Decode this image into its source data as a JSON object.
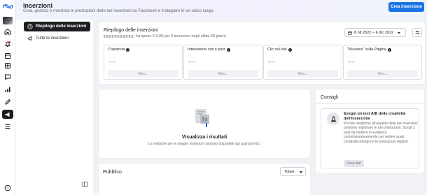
{
  "header": {
    "title": "Inserzioni",
    "subtitle": "Crea, gestisci e monitora le prestazioni delle tue inserzioni su Facebook e Instagram in un unico luogo.",
    "create_button": "Crea inserzione"
  },
  "rail": {
    "icons": [
      "meta-logo",
      "avatar",
      "home-icon",
      "bell-icon",
      "pages-icon",
      "inbox-icon",
      "messages-icon",
      "insights-icon",
      "edit-icon",
      "ads-icon",
      "menu-icon",
      "help-icon"
    ]
  },
  "nav": {
    "items": [
      {
        "label": "Riepilogo delle inserzioni",
        "icon": "overview-icon",
        "active": true
      },
      {
        "label": "Tutte le inserzioni",
        "icon": "megaphone-icon",
        "active": false
      }
    ]
  },
  "summary": {
    "title": "Riepilogo delle inserzioni",
    "description": "ha speso € 0,00 per 0 inserzioni negli ultimi 60 giorni.",
    "date_range": "8 ott 2022 – 6 dic 2022",
    "metrics": [
      {
        "label": "Copertura",
        "value": "––",
        "button": "Altro..."
      },
      {
        "label": "Interazione con il post",
        "value": "––",
        "button": "Altro..."
      },
      {
        "label": "Clic sul link",
        "value": "––",
        "button": "Altro..."
      },
      {
        "label": "\"Mi piace\" sulla Pagina",
        "value": "––",
        "button": "Altro..."
      }
    ]
  },
  "results": {
    "title": "Visualizza i risultati",
    "description": "Le metriche per le singole inserzioni saranno disponibili qui quando inizi."
  },
  "public": {
    "title": "Pubblico",
    "select_value": "Totale"
  },
  "tips": {
    "title": "Consigli",
    "card_title": "Esegui un test A/B delle creatività dell'inserzione",
    "card_body": "Piccole modifiche all'aspetto delle tue inserzioni possono migliorare le tue prestazioni. Scegli 2 post da mettere in evidenza contemporaneamente per vedere quali creatività ottengono le prestazioni migliori.",
    "card_button": "Crea test"
  },
  "colors": {
    "accent": "#1b74e4",
    "active_nav": "#1c1e21",
    "background": "#f0f2f5"
  }
}
